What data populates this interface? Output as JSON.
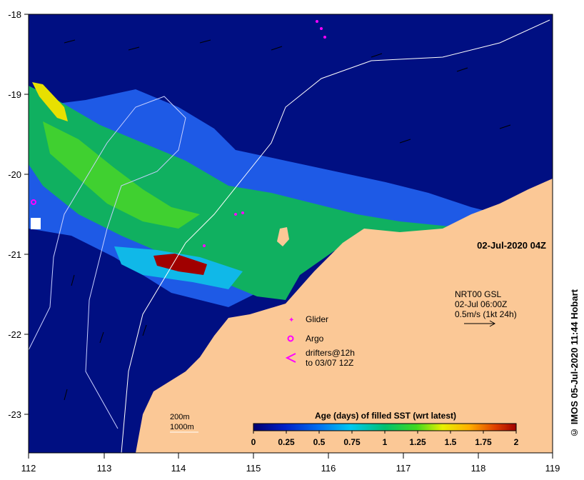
{
  "map": {
    "date_label": "02-Jul-2020 04Z",
    "credit": "© IMOS 05-Jul-2020 11:44 Hobart",
    "lon_ticks": [
      "112",
      "113",
      "114",
      "115",
      "116",
      "117",
      "118",
      "119"
    ],
    "lat_ticks": [
      "-18",
      "-19",
      "-20",
      "-21",
      "-22",
      "-23"
    ],
    "current_legend": {
      "line1": "NRT00 GSL",
      "line2": "02-Jul 06:00Z",
      "line3": "0.5m/s (1kt 24h)"
    },
    "symbol_legend": {
      "glider": "Glider",
      "argo": "Argo",
      "drifters_line1": "drifters@12h",
      "drifters_line2": "to 03/07 12Z"
    },
    "bathymetry": {
      "contour1": "200m",
      "contour2": "1000m"
    },
    "colorbar": {
      "title": "Age (days) of filled SST (wrt latest)",
      "labels": [
        "0",
        "0.25",
        "0.5",
        "0.75",
        "1",
        "1.25",
        "1.5",
        "1.75",
        "2"
      ]
    },
    "colors": {
      "deep": "#000f82",
      "land": "#fbc896",
      "glider": "#ff00ff",
      "coast_white": "#ffffff"
    }
  }
}
